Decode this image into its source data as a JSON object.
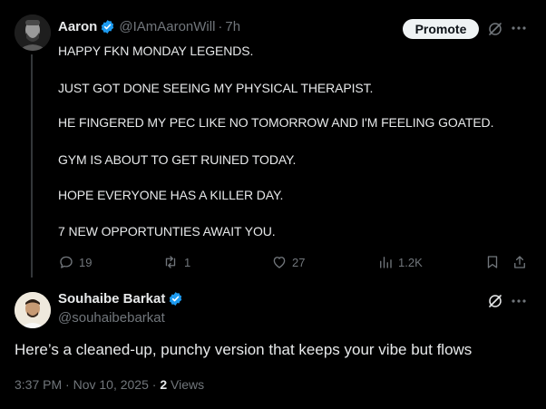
{
  "colors": {
    "background": "#000000",
    "text": "#e7e9ea",
    "muted": "#71767b",
    "verified": "#1d9bf0",
    "divider": "#333639"
  },
  "tweet": {
    "author": {
      "name": "Aaron",
      "handle": "@IAmAaronWill",
      "time": "7h",
      "verified": true,
      "avatar_icon": "avatar-photo"
    },
    "promote_label": "Promote",
    "lines": [
      "HAPPY FKN MONDAY LEGENDS.",
      "JUST GOT DONE SEEING MY PHYSICAL THERAPIST.",
      "HE FINGERED MY PEC LIKE NO TOMORROW AND I'M FEELING GOATED.",
      "GYM IS ABOUT TO GET RUINED TODAY.",
      "HOPE EVERYONE HAS A KILLER DAY.",
      "7 NEW OPPORTUNTIES AWAIT YOU."
    ],
    "stats": {
      "replies": "19",
      "reposts": "1",
      "likes": "27",
      "views": "1.2K"
    }
  },
  "reply": {
    "author": {
      "name": "Souhaibe Barkat",
      "handle": "@souhaibebarkat",
      "verified": true,
      "avatar_icon": "avatar-photo"
    },
    "text": "Here’s a cleaned-up, punchy version that keeps your vibe but flows",
    "timestamp": "3:37 PM · Nov 10, 2025",
    "views_count": "2",
    "views_label": "Views"
  }
}
